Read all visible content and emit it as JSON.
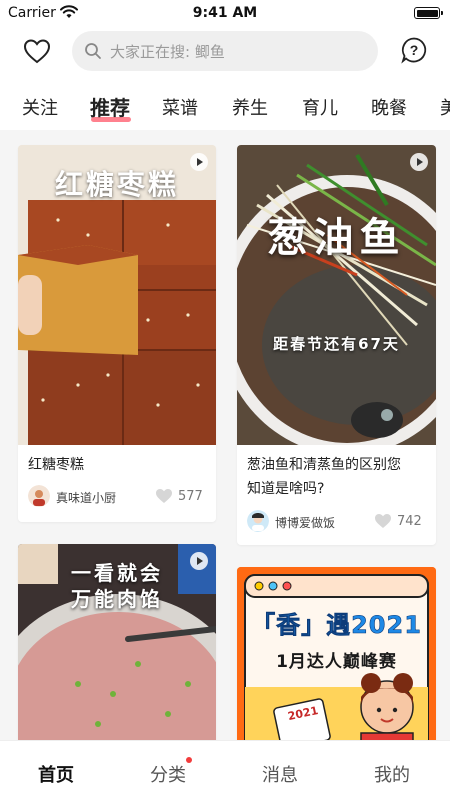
{
  "status": {
    "carrier": "Carrier",
    "time": "9:41 AM"
  },
  "header": {
    "search_placeholder": "大家正在搜: 鲫鱼",
    "icons": [
      "heart-icon",
      "search-icon",
      "help-icon"
    ]
  },
  "tabs": [
    {
      "label": "关注"
    },
    {
      "label": "推荐",
      "active": true
    },
    {
      "label": "菜谱"
    },
    {
      "label": "养生"
    },
    {
      "label": "育儿"
    },
    {
      "label": "晚餐"
    },
    {
      "label": "美"
    }
  ],
  "feed": {
    "cards": [
      {
        "image_text": "红糖枣糕",
        "title": "红糖枣糕",
        "author": "真味道小厨",
        "likes": "577"
      },
      {
        "image_text": "葱油鱼",
        "image_subtext": "距春节还有67天",
        "title_line1": "葱油鱼和清蒸鱼的区别您",
        "title_line2": "知道是啥吗?",
        "author": "博博爱做饭",
        "likes": "742"
      },
      {
        "image_text_line1": "一看就会",
        "image_text_line2": "万能肉馅"
      },
      {
        "image_text": "「香」遇2021",
        "image_subtext": "1月达人巅峰赛",
        "image_badge": "2021"
      }
    ]
  },
  "bottom_nav": [
    {
      "label": "首页",
      "active": true
    },
    {
      "label": "分类",
      "badge": true
    },
    {
      "label": "消息"
    },
    {
      "label": "我的"
    }
  ],
  "colors": {
    "accent": "#ff6b7a",
    "badge": "#f23c3c",
    "promo": "#ff6a13"
  }
}
